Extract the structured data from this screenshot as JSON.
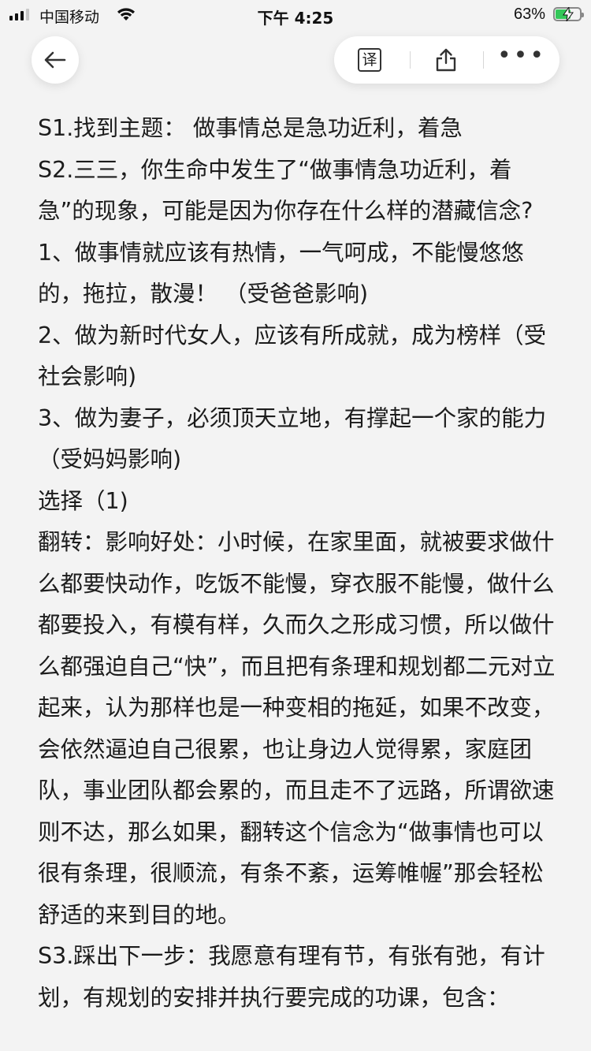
{
  "status_bar": {
    "carrier": "中国移动",
    "time": "下午 4:25",
    "battery_percent": "63%",
    "battery_level": 0.63,
    "battery_color": "#34c759",
    "icons": [
      "signal-icon",
      "wifi-icon",
      "battery-charging-icon"
    ]
  },
  "toolbar": {
    "back_icon": "arrow-left-icon",
    "translate_glyph": "译",
    "share_icon": "share-icon",
    "more_icon": "more-dots-icon",
    "more_glyph": "•••"
  },
  "article": {
    "paragraphs": [
      "S1.找到主题： 做事情总是急功近利，着急",
      "S2.三三，你生命中发生了“做事情急功近利，着急”的现象，可能是因为你存在什么样的潜藏信念?",
      "1、做事情就应该有热情，一气呵成，不能慢悠悠的，拖拉，散漫！ （受爸爸影响)",
      "2、做为新时代女人，应该有所成就，成为榜样（受社会影响)",
      "3、做为妻子，必须顶天立地，有撑起一个家的能力（受妈妈影响)",
      "选择（1)",
      "翻转：影响好处：小时候，在家里面，就被要求做什么都要快动作，吃饭不能慢，穿衣服不能慢，做什么都要投入，有模有样，久而久之形成习惯，所以做什么都强迫自己“快”，而且把有条理和规划都二元对立起来，认为那样也是一种变相的拖延，如果不改变，会依然逼迫自己很累，也让身边人觉得累，家庭团队，事业团队都会累的，而且走不了远路，所谓欲速则不达，那么如果，翻转这个信念为“做事情也可以很有条理，很顺流，有条不紊，运筹帷幄”那会轻松舒适的来到目的地。",
      "S3.踩出下一步：我愿意有理有节，有张有弛，有计划，有规划的安排并执行要完成的功课，包含："
    ]
  }
}
